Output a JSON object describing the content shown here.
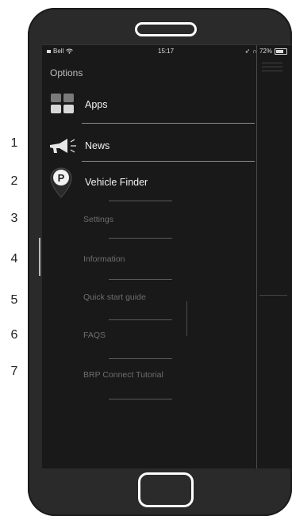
{
  "callouts": [
    "1",
    "2",
    "3",
    "4",
    "5",
    "6",
    "7"
  ],
  "status_bar": {
    "carrier": "Bell",
    "time": "15:17",
    "battery": "72%"
  },
  "header": {
    "title": "Options"
  },
  "menu": {
    "items": [
      {
        "label": "Apps",
        "icon": "apps-grid-icon",
        "style": "primary"
      },
      {
        "label": "News",
        "icon": "megaphone-icon",
        "style": "primary"
      },
      {
        "label": "Vehicle Finder",
        "icon": "parking-pin-icon",
        "style": "primary"
      },
      {
        "label": "Settings",
        "style": "secondary"
      },
      {
        "label": "Information",
        "style": "secondary"
      },
      {
        "label": "Quick start guide",
        "style": "secondary"
      },
      {
        "label": "FAQS",
        "style": "secondary"
      },
      {
        "label": "BRP Connect Tutorial",
        "style": "secondary"
      }
    ]
  },
  "colors": {
    "screen_bg": "#191919",
    "phone_body": "#2a2a2a",
    "primary_text": "#f2f2f2",
    "secondary_text": "#6e6e6e"
  }
}
